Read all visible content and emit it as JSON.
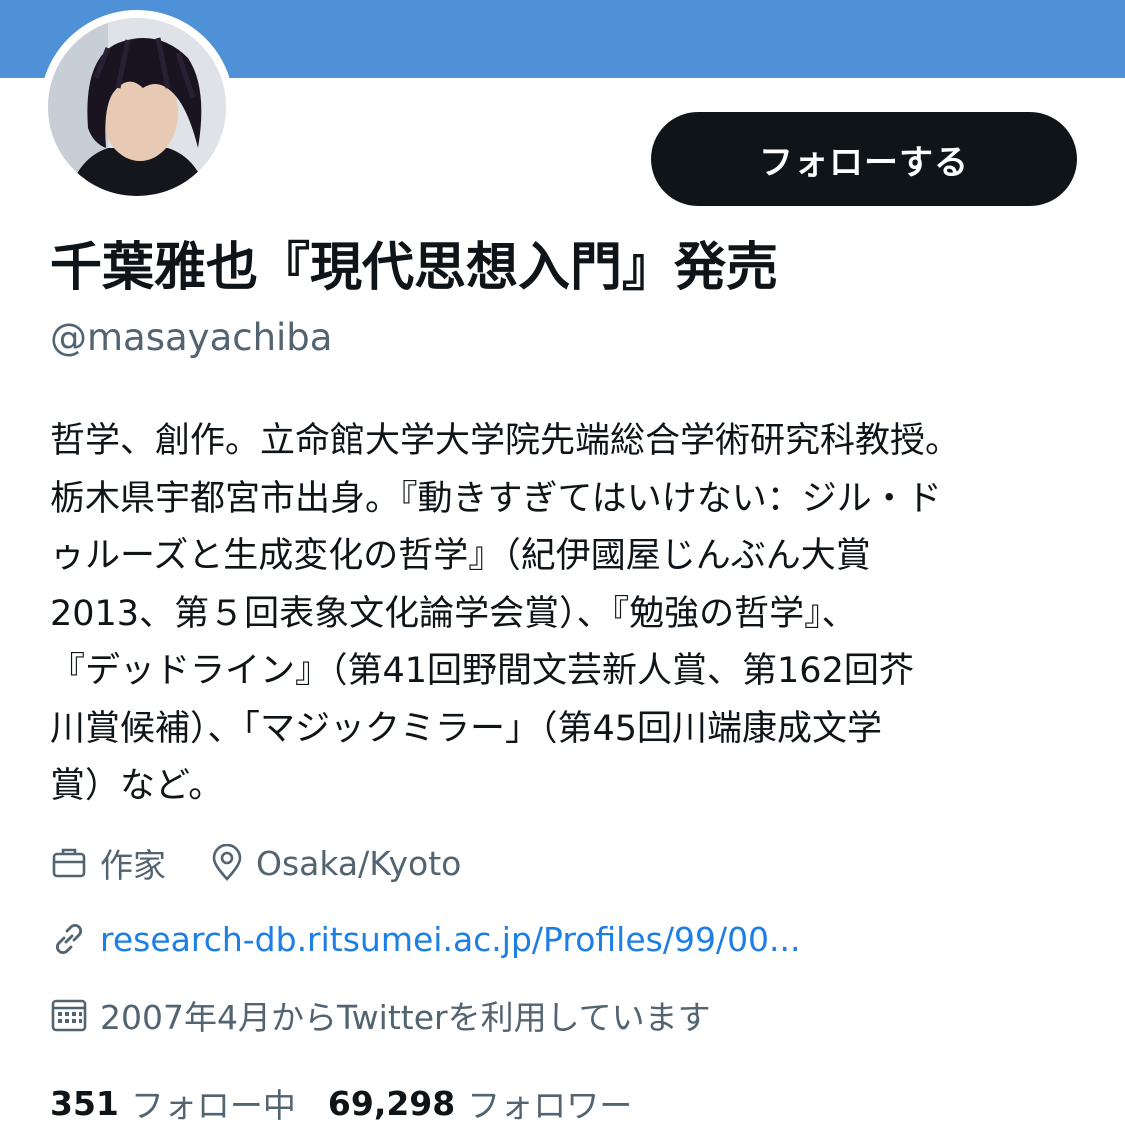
{
  "profile": {
    "display_name": "千葉雅也『現代思想入門』発売",
    "handle": "@masayachiba",
    "follow_label": "フォローする",
    "bio": "哲学、創作。立命館大学大学院先端総合学術研究科教授。\n栃木県宇都宮市出身。『動きすぎてはいけない：ジル・ド\nゥルーズと生成変化の哲学』（紀伊國屋じんぶん大賞\n2013、第５回表象文化論学会賞）、『勉強の哲学』、\n『デッドライン』（第41回野間文芸新人賞、第162回芥\n川賞候補）、「マジックミラー」（第45回川端康成文学\n賞）など。",
    "profession": "作家",
    "location": "Osaka/Kyoto",
    "website": "research-db.ritsumei.ac.jp/Profiles/99/00...",
    "joined": "2007年4月からTwitterを利用しています",
    "following_count": "351",
    "following_label": "フォロー中",
    "followers_count": "69,298",
    "followers_label": "フォロワー"
  },
  "colors": {
    "banner": "#4f91d6",
    "text_primary": "#0f1419",
    "text_secondary": "#536471",
    "link": "#1d7ee4",
    "follow_button_bg": "#0f1419"
  },
  "icons": {
    "profession": "briefcase-icon",
    "location": "location-pin-icon",
    "website": "link-icon",
    "joined": "calendar-icon"
  }
}
